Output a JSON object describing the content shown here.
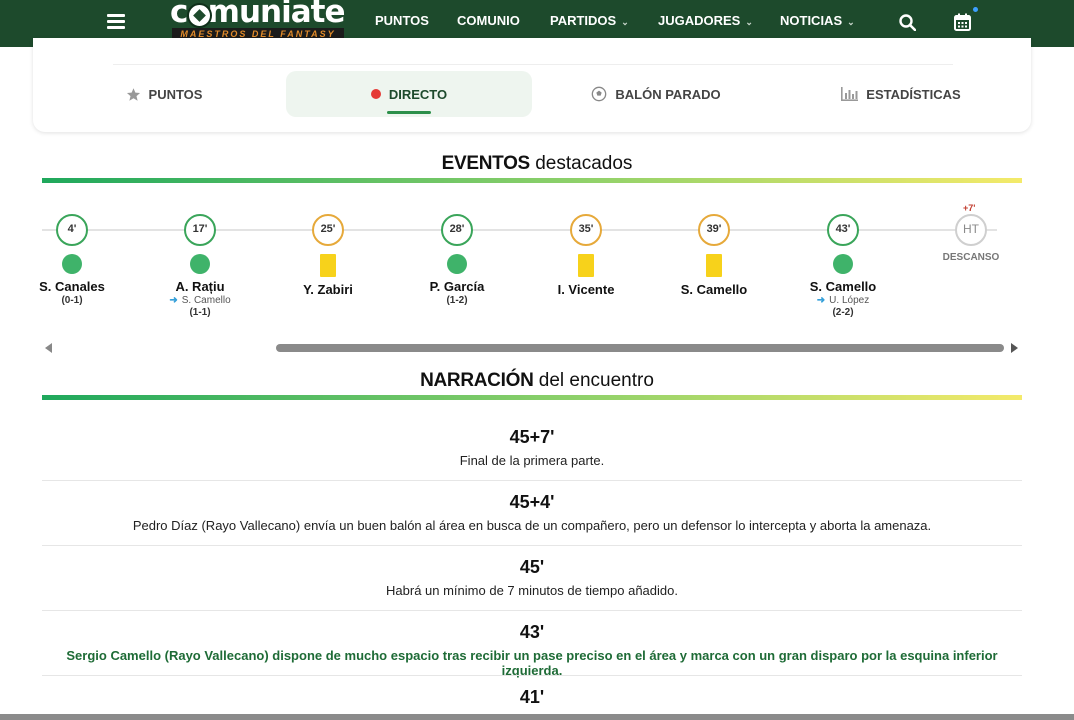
{
  "header": {
    "logo_text": "comuniate",
    "logo_sub": "MAESTROS DEL FANTASY",
    "nav": [
      {
        "label": "PUNTOS",
        "dropdown": false
      },
      {
        "label": "COMUNIO",
        "dropdown": false
      },
      {
        "label": "PARTIDOS",
        "dropdown": true
      },
      {
        "label": "JUGADORES",
        "dropdown": true
      },
      {
        "label": "NOTICIAS",
        "dropdown": true
      }
    ],
    "icons": [
      "menu-icon",
      "search-icon",
      "calendar-icon"
    ],
    "colors": {
      "bar": "#1d4a2c",
      "accent": "#2c8f4a"
    }
  },
  "tabs": [
    {
      "label": "PUNTOS",
      "icon": "star-icon",
      "active": false
    },
    {
      "label": "DIRECTO",
      "icon": "live-dot-icon",
      "active": true
    },
    {
      "label": "BALÓN PARADO",
      "icon": "soccer-ball-icon",
      "active": false
    },
    {
      "label": "ESTADÍSTICAS",
      "icon": "bar-chart-icon",
      "active": false
    }
  ],
  "events_section": {
    "title_bold": "EVENTOS",
    "title_rest": " destacados"
  },
  "events": [
    {
      "minute": "4'",
      "type": "goal",
      "player": "S. Canales",
      "assist": "",
      "score": "(0-1)"
    },
    {
      "minute": "17'",
      "type": "goal",
      "player": "A. Rațiu",
      "assist": "S. Camello",
      "score": "(1-1)"
    },
    {
      "minute": "25'",
      "type": "yellow-card",
      "player": "Y. Zabiri",
      "assist": "",
      "score": ""
    },
    {
      "minute": "28'",
      "type": "goal",
      "player": "P. García",
      "assist": "",
      "score": "(1-2)"
    },
    {
      "minute": "35'",
      "type": "yellow-card",
      "player": "I. Vicente",
      "assist": "",
      "score": ""
    },
    {
      "minute": "39'",
      "type": "yellow-card",
      "player": "S. Camello",
      "assist": "",
      "score": ""
    },
    {
      "minute": "43'",
      "type": "goal",
      "player": "S. Camello",
      "assist": "U. López",
      "score": "(2-2)"
    }
  ],
  "halftime": {
    "extra": "+7'",
    "label": "HT",
    "caption": "DESCANSO"
  },
  "narration_section": {
    "title_bold": "NARRACIÓN",
    "title_rest": " del encuentro"
  },
  "narration": [
    {
      "minute": "45+7'",
      "text": "Final de la primera parte.",
      "highlight": false
    },
    {
      "minute": "45+4'",
      "text": "Pedro Díaz (Rayo Vallecano) envía un buen balón al área en busca de un compañero, pero un defensor lo intercepta y aborta la amenaza.",
      "highlight": false
    },
    {
      "minute": "45'",
      "text": "Habrá un mínimo de 7 minutos de tiempo añadido.",
      "highlight": false
    },
    {
      "minute": "43'",
      "text": "Sergio Camello (Rayo Vallecano) dispone de mucho espacio tras recibir un pase preciso en el área y marca con un gran disparo por la esquina inferior izquierda.",
      "highlight": true
    },
    {
      "minute": "41'",
      "text": "",
      "highlight": false
    }
  ]
}
